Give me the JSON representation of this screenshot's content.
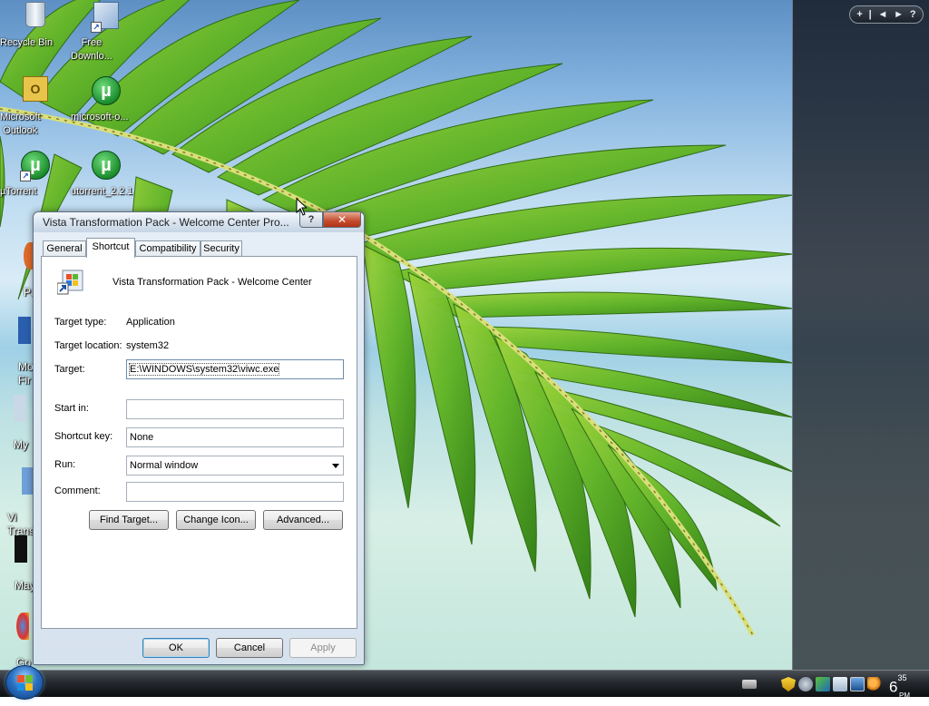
{
  "desktop": {
    "icons": [
      {
        "name": "recycle-bin",
        "label": "Recycle Bin"
      },
      {
        "name": "free-download",
        "label": "Free\nDownlo..."
      },
      {
        "name": "microsoft-outlook",
        "label": "Microsoft\nOutlook"
      },
      {
        "name": "microsoft-o",
        "label": "microsoft-o..."
      },
      {
        "name": "utorrent",
        "label": "µTorrent"
      },
      {
        "name": "utorrent-221",
        "label": "utorrent_2.2.1"
      }
    ],
    "partial_icons": [
      {
        "label": "Pa"
      },
      {
        "label": "Mo\nFir"
      },
      {
        "label": "My"
      },
      {
        "label": "Vi\nTrans"
      },
      {
        "label": "May"
      },
      {
        "label": "Go\nChr"
      }
    ]
  },
  "sidebar": {
    "controls": [
      "+",
      "|",
      "◄",
      "►",
      "?"
    ]
  },
  "dialog": {
    "title": "Vista Transformation Pack - Welcome Center Pro...",
    "help_label": "?",
    "close_label": "✕",
    "tabs": [
      {
        "label": "General",
        "active": false
      },
      {
        "label": "Shortcut",
        "active": true
      },
      {
        "label": "Compatibility",
        "active": false
      },
      {
        "label": "Security",
        "active": false
      }
    ],
    "app_name": "Vista Transformation Pack - Welcome Center",
    "target_type_label": "Target type:",
    "target_type_value": "Application",
    "target_location_label": "Target location:",
    "target_location_value": "system32",
    "target_label": "Target:",
    "target_value": "E:\\WINDOWS\\system32\\viwc.exe",
    "start_in_label": "Start in:",
    "start_in_value": "",
    "shortcut_key_label": "Shortcut key:",
    "shortcut_key_value": "None",
    "run_label": "Run:",
    "run_value": "Normal window",
    "comment_label": "Comment:",
    "comment_value": "",
    "find_target_label": "Find Target...",
    "change_icon_label": "Change Icon...",
    "advanced_label": "Advanced...",
    "ok_label": "OK",
    "cancel_label": "Cancel",
    "apply_label": "Apply"
  },
  "taskbar": {
    "clock_hour": "6",
    "clock_minutes": "35",
    "clock_ampm": "PM",
    "tray_icons": [
      "keyboard-icon",
      "shield-icon",
      "gear-icon",
      "network-icon",
      "display-icon",
      "monitor-icon",
      "search-icon"
    ]
  }
}
